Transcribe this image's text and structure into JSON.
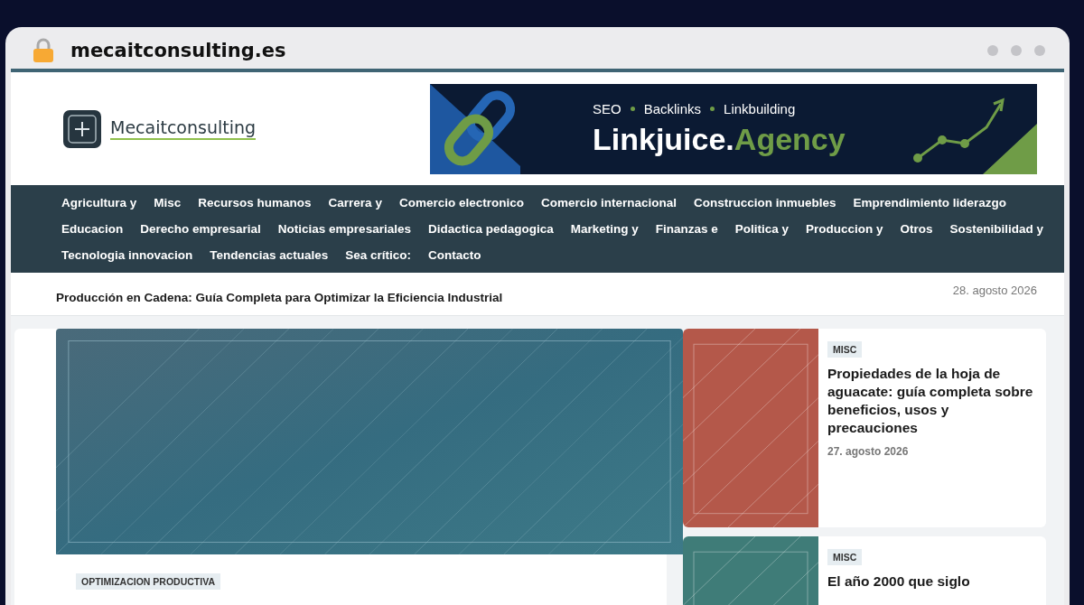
{
  "browser": {
    "url": "mecaitconsulting.es"
  },
  "site": {
    "name": "Mecaitconsulting"
  },
  "banner": {
    "tagline": [
      "SEO",
      "Backlinks",
      "Linkbuilding"
    ],
    "brand": "Linkjuice.",
    "brand_accent": "Agency"
  },
  "nav": {
    "links": [
      "Agricultura y",
      "Misc",
      "Recursos humanos",
      "Carrera y",
      "Comercio electronico",
      "Comercio internacional",
      "Construccion inmuebles",
      "Emprendimiento liderazgo",
      "Educacion",
      "Derecho empresarial",
      "Noticias empresariales",
      "Didactica pedagogica",
      "Marketing y",
      "Finanzas e",
      "Politica y",
      "Produccion y",
      "Otros",
      "Sostenibilidad y",
      "Tecnologia innovacion",
      "Tendencias actuales",
      "Sea crítico:",
      "Contacto"
    ]
  },
  "ticker": {
    "headline": "Producción en Cadena: Guía Completa para Optimizar la Eficiencia Industrial",
    "date": "28. agosto 2026"
  },
  "featured": {
    "kind": "picture",
    "tag": "OPTIMIZACION PRODUCTIVA"
  },
  "side_posts": [
    {
      "tag": "MISC",
      "title": "Propiedades de la hoja de aguacate: guía completa sobre beneficios, usos y precauciones",
      "date": "27. agosto 2026",
      "color": "#b4584a"
    },
    {
      "tag": "MISC",
      "title": "El año 2000 que siglo",
      "color": "#3f7c78"
    }
  ]
}
